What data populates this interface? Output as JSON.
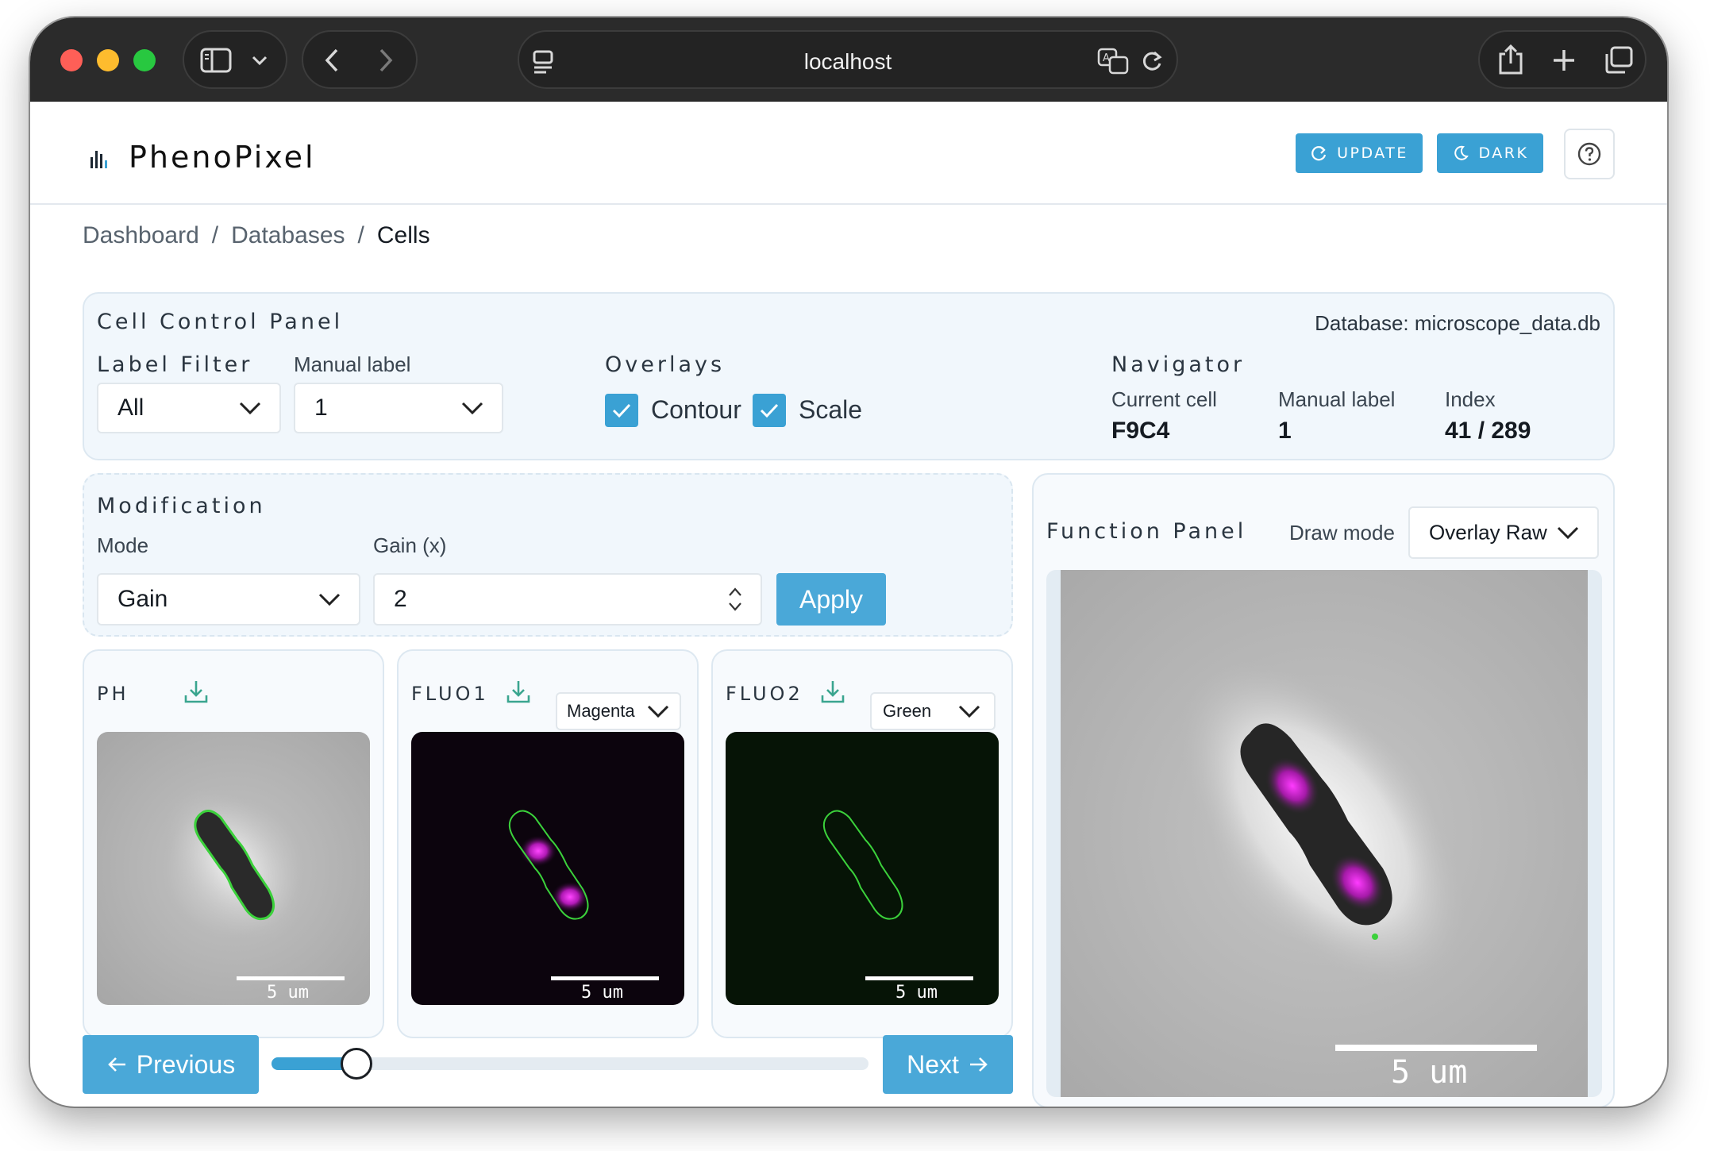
{
  "browser": {
    "url": "localhost"
  },
  "header": {
    "title": "PhenoPixel",
    "update_label": "UPDATE",
    "dark_label": "DARK",
    "accent": "#3aa1d4"
  },
  "breadcrumb": [
    "Dashboard",
    "Databases",
    "Cells"
  ],
  "cell_control": {
    "title": "Cell Control Panel",
    "database_text": "Database: microscope_data.db",
    "label_filter": {
      "label": "Label Filter",
      "value": "All"
    },
    "manual_label": {
      "label": "Manual label",
      "value": "1"
    },
    "overlays": {
      "label": "Overlays",
      "contour": {
        "label": "Contour",
        "checked": true
      },
      "scale": {
        "label": "Scale",
        "checked": true
      }
    },
    "navigator": {
      "label": "Navigator",
      "current_cell_label": "Current cell",
      "current_cell": "F9C4",
      "manual_label_label": "Manual label",
      "manual_label": "1",
      "index_label": "Index",
      "index": "41 / 289"
    }
  },
  "modification": {
    "title": "Modification",
    "mode_label": "Mode",
    "mode_value": "Gain",
    "gain_label": "Gain (x)",
    "gain_value": "2",
    "apply_label": "Apply"
  },
  "channels": [
    {
      "name": "PH",
      "scale": "5 um"
    },
    {
      "name": "FLUO1",
      "color": "Magenta",
      "scale": "5 um"
    },
    {
      "name": "FLUO2",
      "color": "Green",
      "scale": "5 um"
    }
  ],
  "navigation": {
    "previous_label": "Previous",
    "next_label": "Next",
    "slider_fraction": 0.142
  },
  "function_panel": {
    "title": "Function Panel",
    "draw_mode_label": "Draw mode",
    "draw_mode_value": "Overlay Raw",
    "scale": "5 um"
  }
}
